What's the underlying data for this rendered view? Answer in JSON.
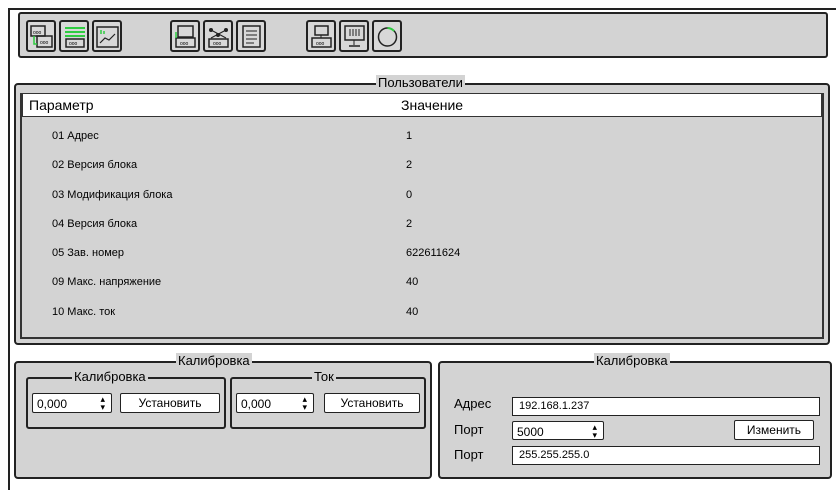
{
  "toolbar": {
    "icons": [
      "modules-icon",
      "list-icon",
      "chart-icon",
      "device-icon",
      "network-icon",
      "document-icon",
      "computer-icon",
      "monitor-icon",
      "power-icon"
    ]
  },
  "users": {
    "title": "Пользователи",
    "columns": [
      "Параметр",
      "Значение"
    ],
    "rows": [
      {
        "param": "01 Адрес",
        "value": "1"
      },
      {
        "param": "02 Версия блока",
        "value": "2"
      },
      {
        "param": "03 Модификация блока",
        "value": "0"
      },
      {
        "param": "04 Версия блока",
        "value": "2"
      },
      {
        "param": "05 Зав. номер",
        "value": "622611624"
      },
      {
        "param": "09 Макс. напряжение",
        "value": "40"
      },
      {
        "param": "10 Макс. ток",
        "value": "40"
      }
    ]
  },
  "calibration_left": {
    "title": "Калибровка",
    "calibration": {
      "title": "Калибровка",
      "value": "0,000",
      "button": "Установить"
    },
    "current": {
      "title": "Ток",
      "value": "0,000",
      "button": "Установить"
    }
  },
  "calibration_right": {
    "title": "Калибровка",
    "address_label": "Адрес",
    "address_value": "192.168.1.237",
    "port_label": "Порт",
    "port_value": "5000",
    "change_button": "Изменить",
    "mask_label": "Порт",
    "mask_value": "255.255.255.0"
  },
  "colors": {
    "panel": "#d3d3d3",
    "accent": "#2ecc40"
  }
}
